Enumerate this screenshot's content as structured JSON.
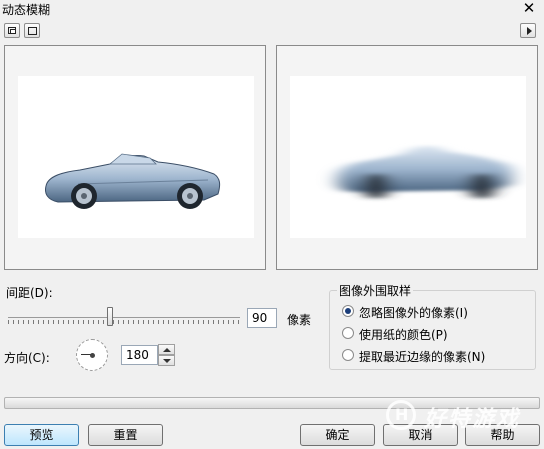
{
  "window": {
    "title": "动态模糊"
  },
  "controls": {
    "distance": {
      "label": "间距(D):",
      "value": "90",
      "unit": "像素",
      "slider_fraction": 0.44
    },
    "direction": {
      "label": "方向(C):",
      "value": "180"
    }
  },
  "sampling": {
    "title": "图像外围取样",
    "options": [
      {
        "label": "忽略图像外的像素(I)",
        "selected": true
      },
      {
        "label": "使用纸的颜色(P)",
        "selected": false
      },
      {
        "label": "提取最近边缘的像素(N)",
        "selected": false
      }
    ]
  },
  "buttons": {
    "preview": "预览",
    "reset": "重置",
    "ok": "确定",
    "cancel": "取消",
    "help": "帮助"
  },
  "watermark": {
    "text": "好特游戏",
    "logo_letter": "H"
  },
  "colors": {
    "default_button": "#bee6fd",
    "radio_selected": "#1b3e7a"
  }
}
